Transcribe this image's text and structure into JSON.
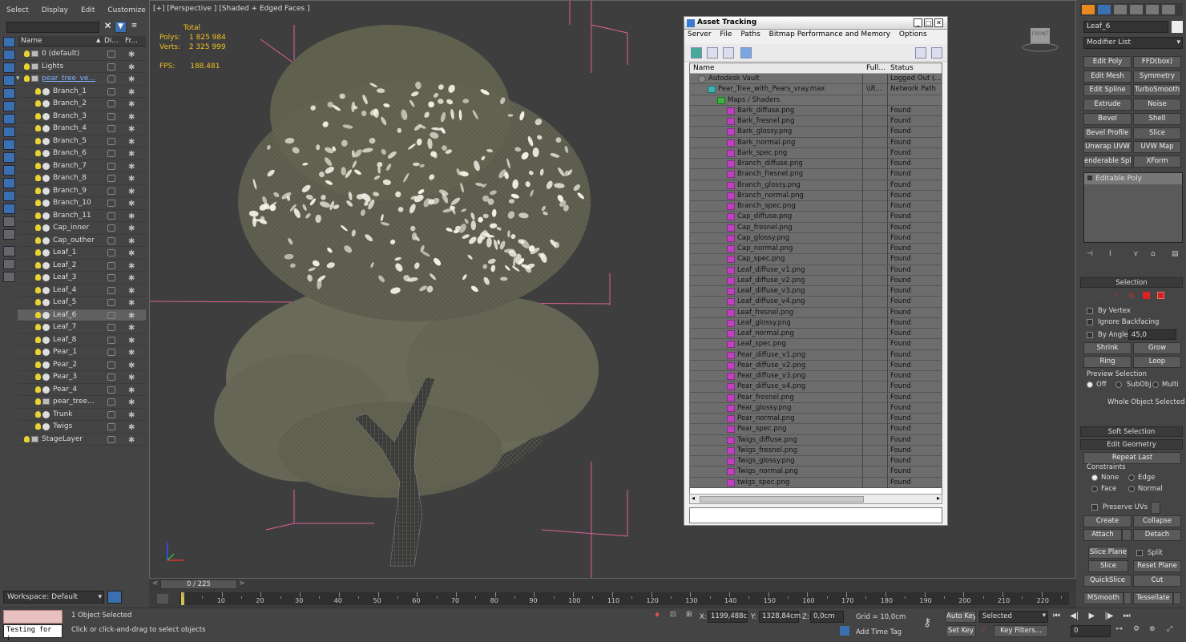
{
  "scene_explorer": {
    "menu": [
      "Select",
      "Display",
      "Edit",
      "Customize"
    ],
    "columns": {
      "name": "Name",
      "display": "Di...",
      "frozen": "Fr..."
    },
    "rows": [
      {
        "label": "0 (default)",
        "type": "layer",
        "indent": 1
      },
      {
        "label": "Lights",
        "type": "layer",
        "indent": 1
      },
      {
        "label": "pear_tree_ve...",
        "type": "layer",
        "indent": 1,
        "highlight": "link"
      },
      {
        "label": "Branch_1",
        "type": "object",
        "indent": 2
      },
      {
        "label": "Branch_2",
        "type": "object",
        "indent": 2
      },
      {
        "label": "Branch_3",
        "type": "object",
        "indent": 2
      },
      {
        "label": "Branch_4",
        "type": "object",
        "indent": 2
      },
      {
        "label": "Branch_5",
        "type": "object",
        "indent": 2
      },
      {
        "label": "Branch_6",
        "type": "object",
        "indent": 2
      },
      {
        "label": "Branch_7",
        "type": "object",
        "indent": 2
      },
      {
        "label": "Branch_8",
        "type": "object",
        "indent": 2
      },
      {
        "label": "Branch_9",
        "type": "object",
        "indent": 2
      },
      {
        "label": "Branch_10",
        "type": "object",
        "indent": 2
      },
      {
        "label": "Branch_11",
        "type": "object",
        "indent": 2
      },
      {
        "label": "Cap_inner",
        "type": "object",
        "indent": 2
      },
      {
        "label": "Cap_outher",
        "type": "object",
        "indent": 2
      },
      {
        "label": "Leaf_1",
        "type": "object",
        "indent": 2
      },
      {
        "label": "Leaf_2",
        "type": "object",
        "indent": 2
      },
      {
        "label": "Leaf_3",
        "type": "object",
        "indent": 2
      },
      {
        "label": "Leaf_4",
        "type": "object",
        "indent": 2
      },
      {
        "label": "Leaf_5",
        "type": "object",
        "indent": 2
      },
      {
        "label": "Leaf_6",
        "type": "object",
        "indent": 2,
        "selected": true
      },
      {
        "label": "Leaf_7",
        "type": "object",
        "indent": 2
      },
      {
        "label": "Leaf_8",
        "type": "object",
        "indent": 2
      },
      {
        "label": "Pear_1",
        "type": "object",
        "indent": 2
      },
      {
        "label": "Pear_2",
        "type": "object",
        "indent": 2
      },
      {
        "label": "Pear_3",
        "type": "object",
        "indent": 2
      },
      {
        "label": "Pear_4",
        "type": "object",
        "indent": 2
      },
      {
        "label": "pear_tree...",
        "type": "layerobj",
        "indent": 2
      },
      {
        "label": "Trunk",
        "type": "object",
        "indent": 2
      },
      {
        "label": "Twigs",
        "type": "object",
        "indent": 2
      },
      {
        "label": "StageLayer",
        "type": "layer",
        "indent": 1
      }
    ],
    "workspace": "Workspace: Default"
  },
  "viewport": {
    "label": "[+] [Perspective ] [Shaded + Edged Faces ]",
    "stats": {
      "total": "Total",
      "polys_label": "Polys:",
      "polys": "1 825 984",
      "verts_label": "Verts:",
      "verts": "2 325 999",
      "fps_label": "FPS:",
      "fps": "188.481"
    },
    "viewcube": "FRONT"
  },
  "asset_tracking": {
    "title": "Asset Tracking",
    "menu": [
      "Server",
      "File",
      "Paths",
      "Bitmap Performance and Memory",
      "Options"
    ],
    "columns": {
      "name": "Name",
      "full": "Full...",
      "status": "Status"
    },
    "rows": [
      {
        "name": "Autodesk Vault",
        "full": "",
        "status": "Logged Out (...",
        "level": 0,
        "icon": "vault"
      },
      {
        "name": "Pear_Tree_with_Pears_vray.max",
        "full": "\\\\R...",
        "status": "Network Path",
        "level": 1,
        "icon": "max"
      },
      {
        "name": "Maps / Shaders",
        "full": "",
        "status": "",
        "level": 2,
        "icon": "maps"
      },
      {
        "name": "Bark_diffuse.png",
        "full": "",
        "status": "Found",
        "level": 3,
        "icon": "png"
      },
      {
        "name": "Bark_fresnel.png",
        "full": "",
        "status": "Found",
        "level": 3,
        "icon": "png"
      },
      {
        "name": "Bark_glossy.png",
        "full": "",
        "status": "Found",
        "level": 3,
        "icon": "png"
      },
      {
        "name": "Bark_normal.png",
        "full": "",
        "status": "Found",
        "level": 3,
        "icon": "png"
      },
      {
        "name": "Bark_spec.png",
        "full": "",
        "status": "Found",
        "level": 3,
        "icon": "png"
      },
      {
        "name": "Branch_diffuse.png",
        "full": "",
        "status": "Found",
        "level": 3,
        "icon": "png"
      },
      {
        "name": "Branch_fresnel.png",
        "full": "",
        "status": "Found",
        "level": 3,
        "icon": "png"
      },
      {
        "name": "Branch_glossy.png",
        "full": "",
        "status": "Found",
        "level": 3,
        "icon": "png"
      },
      {
        "name": "Branch_normal.png",
        "full": "",
        "status": "Found",
        "level": 3,
        "icon": "png"
      },
      {
        "name": "Branch_spec.png",
        "full": "",
        "status": "Found",
        "level": 3,
        "icon": "png"
      },
      {
        "name": "Cap_diffuse.png",
        "full": "",
        "status": "Found",
        "level": 3,
        "icon": "png"
      },
      {
        "name": "Cap_fresnel.png",
        "full": "",
        "status": "Found",
        "level": 3,
        "icon": "png"
      },
      {
        "name": "Cap_glossy.png",
        "full": "",
        "status": "Found",
        "level": 3,
        "icon": "png"
      },
      {
        "name": "Cap_normal.png",
        "full": "",
        "status": "Found",
        "level": 3,
        "icon": "png"
      },
      {
        "name": "Cap_spec.png",
        "full": "",
        "status": "Found",
        "level": 3,
        "icon": "png"
      },
      {
        "name": "Leaf_diffuse_v1.png",
        "full": "",
        "status": "Found",
        "level": 3,
        "icon": "png"
      },
      {
        "name": "Leaf_diffuse_v2.png",
        "full": "",
        "status": "Found",
        "level": 3,
        "icon": "png"
      },
      {
        "name": "Leaf_diffuse_v3.png",
        "full": "",
        "status": "Found",
        "level": 3,
        "icon": "png"
      },
      {
        "name": "Leaf_diffuse_v4.png",
        "full": "",
        "status": "Found",
        "level": 3,
        "icon": "png"
      },
      {
        "name": "Leaf_fresnel.png",
        "full": "",
        "status": "Found",
        "level": 3,
        "icon": "png"
      },
      {
        "name": "Leaf_glossy.png",
        "full": "",
        "status": "Found",
        "level": 3,
        "icon": "png"
      },
      {
        "name": "Leaf_normal.png",
        "full": "",
        "status": "Found",
        "level": 3,
        "icon": "png"
      },
      {
        "name": "Leaf_spec.png",
        "full": "",
        "status": "Found",
        "level": 3,
        "icon": "png"
      },
      {
        "name": "Pear_diffuse_v1.png",
        "full": "",
        "status": "Found",
        "level": 3,
        "icon": "png"
      },
      {
        "name": "Pear_diffuse_v2.png",
        "full": "",
        "status": "Found",
        "level": 3,
        "icon": "png"
      },
      {
        "name": "Pear_diffuse_v3.png",
        "full": "",
        "status": "Found",
        "level": 3,
        "icon": "png"
      },
      {
        "name": "Pear_diffuse_v4.png",
        "full": "",
        "status": "Found",
        "level": 3,
        "icon": "png"
      },
      {
        "name": "Pear_fresnel.png",
        "full": "",
        "status": "Found",
        "level": 3,
        "icon": "png"
      },
      {
        "name": "Pear_glossy.png",
        "full": "",
        "status": "Found",
        "level": 3,
        "icon": "png"
      },
      {
        "name": "Pear_normal.png",
        "full": "",
        "status": "Found",
        "level": 3,
        "icon": "png"
      },
      {
        "name": "Pear_spec.png",
        "full": "",
        "status": "Found",
        "level": 3,
        "icon": "png"
      },
      {
        "name": "Twigs_diffuse.png",
        "full": "",
        "status": "Found",
        "level": 3,
        "icon": "png"
      },
      {
        "name": "Twigs_fresnel.png",
        "full": "",
        "status": "Found",
        "level": 3,
        "icon": "png"
      },
      {
        "name": "Twigs_glossy.png",
        "full": "",
        "status": "Found",
        "level": 3,
        "icon": "png"
      },
      {
        "name": "Twigs_normal.png",
        "full": "",
        "status": "Found",
        "level": 3,
        "icon": "png"
      },
      {
        "name": "twigs_spec.png",
        "full": "",
        "status": "Found",
        "level": 3,
        "icon": "png"
      }
    ]
  },
  "command_panel": {
    "object_name": "Leaf_6",
    "modifier_list": "Modifier List",
    "modifier_buttons": [
      "Edit Poly",
      "FFD(box)",
      "Edit Mesh",
      "Symmetry",
      "Edit Spline",
      "TurboSmooth",
      "Extrude",
      "Noise",
      "Bevel",
      "Shell",
      "Bevel Profile",
      "Slice",
      "Unwrap UVW",
      "UVW Map",
      "enderable Splin",
      "XForm"
    ],
    "stack_item": "Editable Poly",
    "selection": {
      "title": "Selection",
      "by_vertex": "By Vertex",
      "ignore_backfacing": "Ignore Backfacing",
      "by_angle": "By Angle:",
      "angle": "45,0",
      "shrink": "Shrink",
      "grow": "Grow",
      "ring": "Ring",
      "loop": "Loop",
      "preview_title": "Preview Selection",
      "off": "Off",
      "subobj": "SubObj",
      "multi": "Multi",
      "status": "Whole Object Selected"
    },
    "soft_selection": "Soft Selection",
    "edit_geometry": {
      "title": "Edit Geometry",
      "repeat_last": "Repeat Last",
      "constraints": "Constraints",
      "none": "None",
      "edge": "Edge",
      "face": "Face",
      "normal": "Normal",
      "preserve_uvs": "Preserve UVs",
      "create": "Create",
      "collapse": "Collapse",
      "attach": "Attach",
      "detach": "Detach",
      "slice_plane": "Slice Plane",
      "split": "Split",
      "slice": "Slice",
      "reset_plane": "Reset Plane",
      "quickslice": "QuickSlice",
      "cut": "Cut",
      "msmooth": "MSmooth",
      "tessellate": "Tessellate"
    }
  },
  "timeline": {
    "frame": "0 / 225",
    "ticks": [
      "10",
      "20",
      "30",
      "40",
      "50",
      "60",
      "70",
      "80",
      "90",
      "100",
      "110",
      "120",
      "130",
      "140",
      "150",
      "160",
      "170",
      "180",
      "190",
      "200",
      "210",
      "220"
    ]
  },
  "status_bar": {
    "script": "Testing for ;",
    "selected": "1 Object Selected",
    "prompt": "Click or click-and-drag to select objects",
    "x_label": "X:",
    "x": "1199,488c",
    "y_label": "Y:",
    "y": "1328,84cm",
    "z_label": "Z:",
    "z": "0,0cm",
    "grid": "Grid = 10,0cm",
    "add_time_tag": "Add Time Tag",
    "auto_key": "Auto Key",
    "set_key": "Set Key",
    "selected_dropdown": "Selected",
    "key_filters": "Key Filters...",
    "current_frame": "0"
  }
}
